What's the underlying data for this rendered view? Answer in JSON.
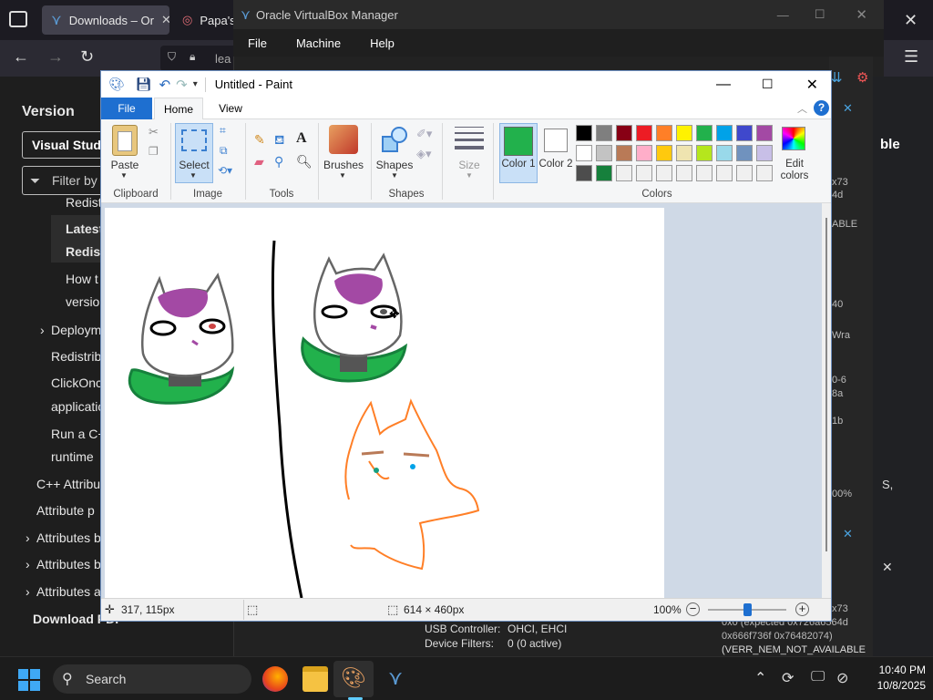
{
  "browser": {
    "tabs": [
      {
        "label": "Downloads – Or"
      },
      {
        "label": "Papa's"
      }
    ],
    "address_fragment": "lea"
  },
  "docs_sidebar": {
    "version_heading": "Version",
    "version_select": "Visual Studi",
    "filter_placeholder": "Filter by",
    "items": [
      "Redist",
      "Latest",
      "Redist",
      "How t",
      "versio",
      "Deploym",
      "Redistrib",
      "ClickOnc",
      "applicatio",
      "Run a C+",
      "runtime",
      "C++ Attribu",
      "Attribute p",
      "Attributes b",
      "Attributes b",
      "Attributes a",
      "Download PDF"
    ]
  },
  "virtualbox": {
    "title": "Oracle VirtualBox Manager",
    "menu": [
      "File",
      "Machine",
      "Help"
    ],
    "details": [
      {
        "key": "USB Controller:",
        "value": "OHCI, EHCI"
      },
      {
        "key": "Device Filters:",
        "value": "0 (0 active)"
      }
    ],
    "right_fragments": [
      "ble",
      "x73",
      "4d",
      "ABLE",
      "40",
      "Wra",
      "0-6",
      "8a",
      "1b",
      "00%",
      "S,",
      "x73",
      "0x0 (expected 0x726a6564d",
      "0x666f736f 0x76482074)",
      "(VERR_NEM_NOT_AVAILABLE"
    ]
  },
  "paint": {
    "title": "Untitled - Paint",
    "tabs": [
      "File",
      "Home",
      "View"
    ],
    "groups": {
      "clipboard": {
        "label": "Clipboard",
        "paste": "Paste"
      },
      "image": {
        "label": "Image",
        "select": "Select"
      },
      "tools": {
        "label": "Tools"
      },
      "brushes": {
        "label": "Brushes"
      },
      "shapes": {
        "label": "Shapes",
        "shapes_btn": "Shapes"
      },
      "size": {
        "label": "Size"
      },
      "colors": {
        "label": "Colors",
        "color1": "Color 1",
        "color2": "Color 2",
        "edit": "Edit colors"
      }
    },
    "color1_value": "#22b14c",
    "color2_value": "#ffffff",
    "palette_row1": [
      "#000000",
      "#7f7f7f",
      "#880015",
      "#ed1c24",
      "#ff7f27",
      "#fff200",
      "#22b14c",
      "#00a2e8",
      "#3f48cc",
      "#a349a4"
    ],
    "palette_row2": [
      "#ffffff",
      "#c3c3c3",
      "#b97a57",
      "#ffaec9",
      "#ffc90e",
      "#efe4b0",
      "#b5e61d",
      "#99d9ea",
      "#7092be",
      "#c8bfe7"
    ],
    "palette_row3": [
      "#4d4d4d",
      "#16803c",
      "#f0f0f0",
      "#f0f0f0",
      "#f0f0f0",
      "#f0f0f0",
      "#f0f0f0",
      "#f0f0f0",
      "#f0f0f0",
      "#f0f0f0"
    ],
    "status": {
      "cursor_pos": "317, 115px",
      "canvas_size": "614 × 460px",
      "zoom": "100%",
      "zoom_fraction": 0.5
    }
  },
  "taskbar": {
    "search_label": "Search",
    "time": "10:40 PM",
    "date": "10/8/2025"
  }
}
